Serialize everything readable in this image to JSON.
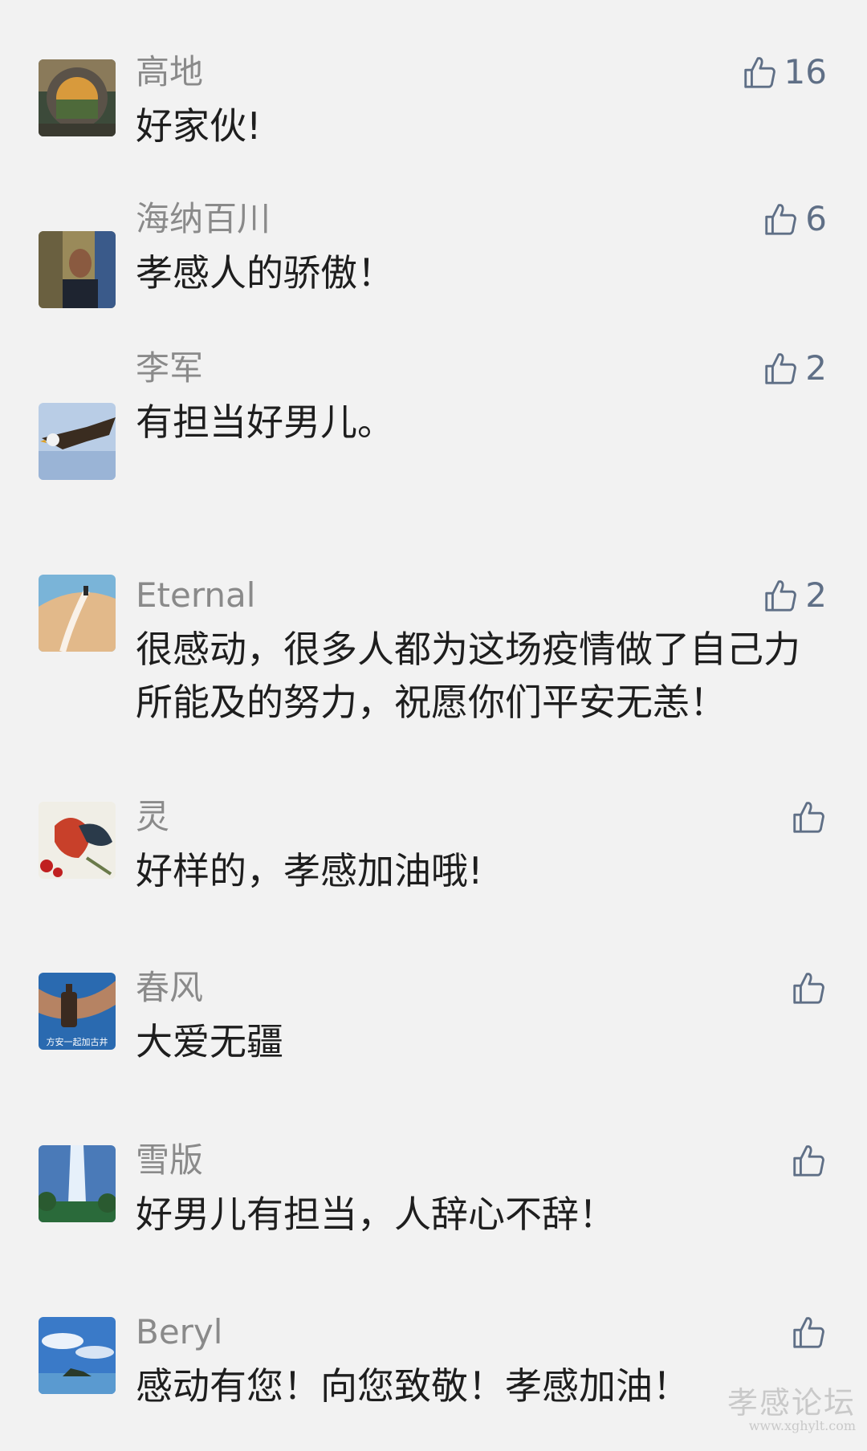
{
  "comments": [
    {
      "name": "高地",
      "text": "好家伙!",
      "likes": "16"
    },
    {
      "name": "海纳百川",
      "text": "孝感人的骄傲！",
      "likes": "6"
    },
    {
      "name": "李军",
      "text": "有担当好男儿。",
      "likes": "2"
    },
    {
      "name": "Eternal",
      "text": "很感动，很多人都为这场疫情做了自己力所能及的努力，祝愿你们平安无恙！",
      "likes": "2"
    },
    {
      "name": "灵",
      "text": "好样的，孝感加油哦!",
      "likes": ""
    },
    {
      "name": "春风",
      "text": "大爱无疆",
      "likes": ""
    },
    {
      "name": "雪版",
      "text": "好男儿有担当，人辞心不辞！",
      "likes": ""
    },
    {
      "name": "Beryl",
      "text": "感动有您！向您致敬！孝感加油！",
      "likes": ""
    }
  ],
  "avatar_texts": {
    "chunfeng": "方安一起加古井"
  },
  "watermark": {
    "title": "孝感论坛",
    "url": "www.xghylt.com"
  },
  "icons": {
    "like": "thumbs-up-icon"
  },
  "colors": {
    "background": "#f2f2f2",
    "name": "#8a8a8a",
    "text": "#1e1e1e",
    "like": "#5f6f86"
  }
}
